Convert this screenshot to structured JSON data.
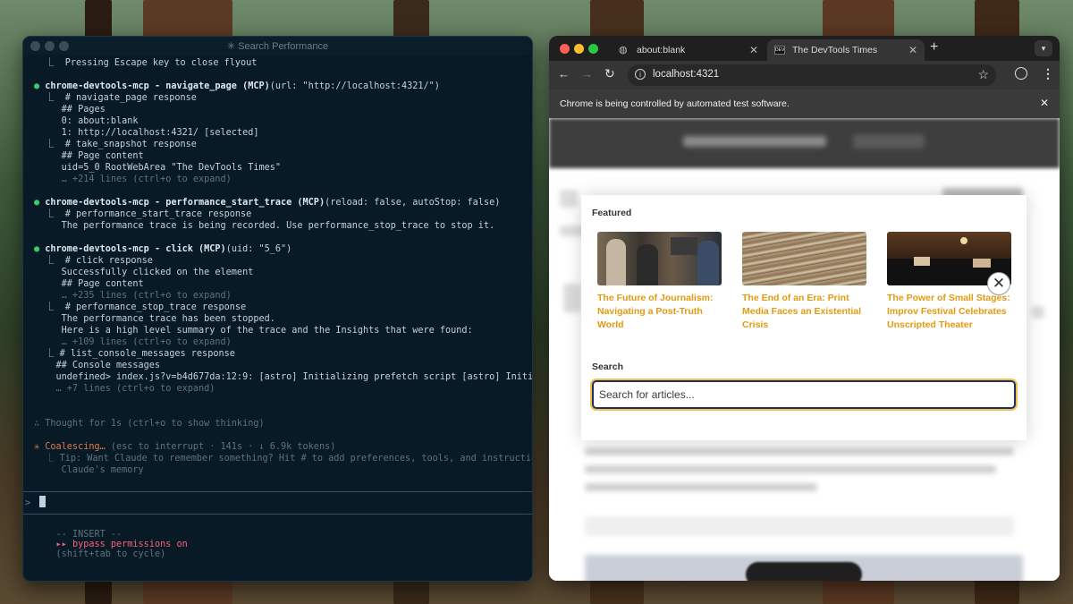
{
  "terminal": {
    "title": "✳ Search Performance",
    "lines": [
      {
        "t": "  ⎿  Pressing Escape key to close flyout",
        "c": ""
      },
      {
        "t": "",
        "c": ""
      },
      {
        "t": "● chrome-devtools-mcp - navigate_page (MCP)(url: \"http://localhost:4321/\")",
        "c": "tool"
      },
      {
        "t": "  ⎿  # navigate_page response",
        "c": ""
      },
      {
        "t": "     ## Pages",
        "c": ""
      },
      {
        "t": "     0: about:blank",
        "c": ""
      },
      {
        "t": "     1: http://localhost:4321/ [selected]",
        "c": ""
      },
      {
        "t": "  ⎿  # take_snapshot response",
        "c": ""
      },
      {
        "t": "     ## Page content",
        "c": ""
      },
      {
        "t": "     uid=5_0 RootWebArea \"The DevTools Times\"",
        "c": ""
      },
      {
        "t": "     … +214 lines (ctrl+o to expand)",
        "c": "dim"
      },
      {
        "t": "",
        "c": ""
      },
      {
        "t": "● chrome-devtools-mcp - performance_start_trace (MCP)(reload: false, autoStop: false)",
        "c": "tool"
      },
      {
        "t": "  ⎿  # performance_start_trace response",
        "c": ""
      },
      {
        "t": "     The performance trace is being recorded. Use performance_stop_trace to stop it.",
        "c": ""
      },
      {
        "t": "",
        "c": ""
      },
      {
        "t": "● chrome-devtools-mcp - click (MCP)(uid: \"5_6\")",
        "c": "tool"
      },
      {
        "t": "  ⎿  # click response",
        "c": ""
      },
      {
        "t": "     Successfully clicked on the element",
        "c": ""
      },
      {
        "t": "     ## Page content",
        "c": ""
      },
      {
        "t": "     … +235 lines (ctrl+o to expand)",
        "c": "dim"
      },
      {
        "t": "  ⎿  # performance_stop_trace response",
        "c": ""
      },
      {
        "t": "     The performance trace has been stopped.",
        "c": ""
      },
      {
        "t": "     Here is a high level summary of the trace and the Insights that were found:",
        "c": ""
      },
      {
        "t": "     … +109 lines (ctrl+o to expand)",
        "c": "dim"
      },
      {
        "t": "  ⎿ # list_console_messages response",
        "c": ""
      },
      {
        "t": "    ## Console messages",
        "c": ""
      },
      {
        "t": "    undefined> index.js?v=b4d677da:12:9: [astro] Initializing prefetch script [astro] Initi",
        "c": ""
      },
      {
        "t": "    … +7 lines (ctrl+o to expand)",
        "c": "dim"
      },
      {
        "t": "",
        "c": ""
      },
      {
        "t": "",
        "c": ""
      },
      {
        "t": "∴ Thought for 1s (ctrl+o to show thinking)",
        "c": "dim"
      },
      {
        "t": "",
        "c": ""
      },
      {
        "t": "✳ Coalescing… (esc to interrupt · 141s · ↓ 6.9k tokens)",
        "c": "status"
      },
      {
        "t": "  ⎿ Tip: Want Claude to remember something? Hit # to add preferences, tools, and instructions to",
        "c": "dim"
      },
      {
        "t": "     Claude's memory",
        "c": "dim"
      }
    ],
    "prompt_symbol": ">",
    "footer_mode": "-- INSERT --",
    "footer_permissions": "▸▸ bypass permissions on",
    "footer_hint": "(shift+tab to cycle)"
  },
  "browser": {
    "tabs": [
      {
        "label": "about:blank",
        "active": false
      },
      {
        "label": "The DevTools Times",
        "active": true
      }
    ],
    "url": "localhost:4321",
    "info_bar": "Chrome is being controlled by automated test software.",
    "flyout": {
      "featured_heading": "Featured",
      "cards": [
        {
          "title": "The Future of Journalism: Navigating a Post-Truth World"
        },
        {
          "title": "The End of an Era: Print Media Faces an Existential Crisis"
        },
        {
          "title": "The Power of Small Stages: Improv Festival Celebrates Unscripted Theater"
        }
      ],
      "search_heading": "Search",
      "search_placeholder": "Search for articles..."
    }
  },
  "colors": {
    "accent_orange": "#e49a0f",
    "terminal_bg": "#071a26",
    "search_focus": "#1e2d6b"
  }
}
